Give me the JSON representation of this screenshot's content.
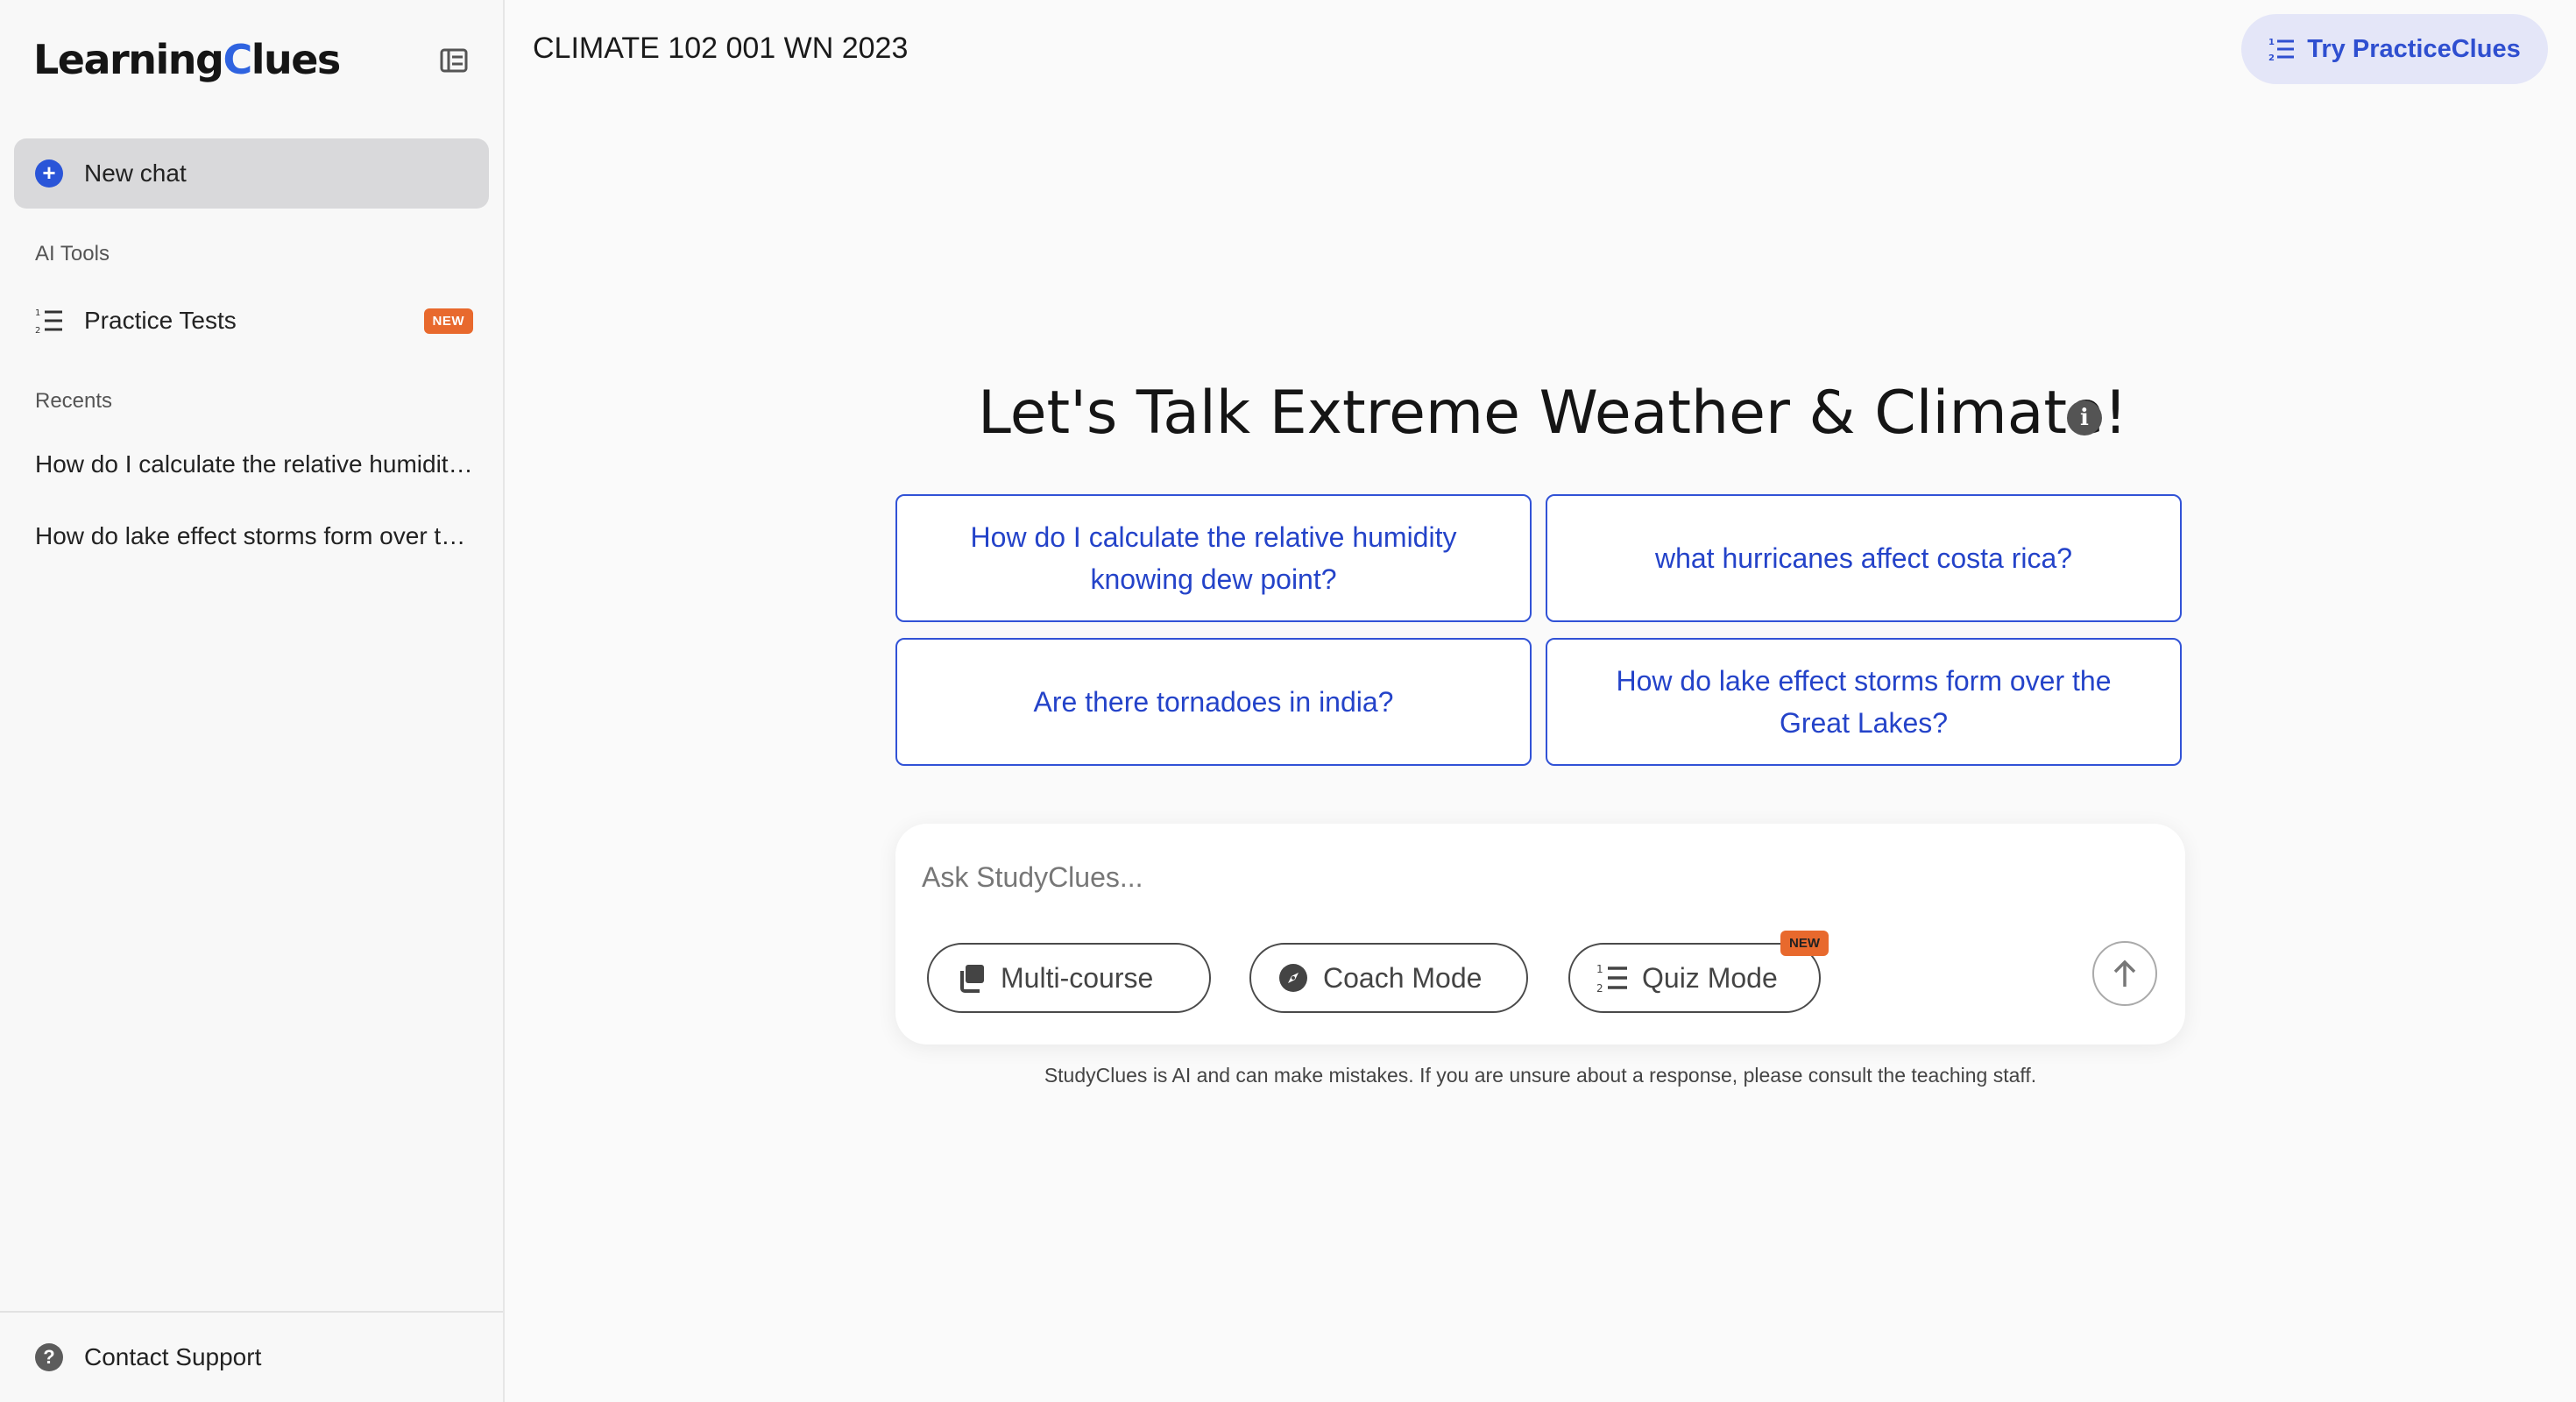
{
  "sidebar": {
    "logo": {
      "part1": "Learning",
      "part2": "C",
      "part3": "lues"
    },
    "new_chat_label": "New chat",
    "ai_tools_label": "AI Tools",
    "practice_tests_label": "Practice Tests",
    "practice_tests_badge": "NEW",
    "recents_label": "Recents",
    "recents": [
      "How do I calculate the relative humidity knowing dew point?",
      "How do lake effect storms form over the Great Lakes?"
    ],
    "contact_support_label": "Contact Support"
  },
  "header": {
    "course_title": "CLIMATE 102 001 WN 2023",
    "try_button_label": "Try PracticeClues"
  },
  "main": {
    "headline": "Let's Talk Extreme Weather & Climate!",
    "suggestions": [
      "How do I calculate the relative humidity knowing dew point?",
      "what hurricanes affect costa rica?",
      "Are there tornadoes in india?",
      "How do lake effect storms form over the Great Lakes?"
    ],
    "composer": {
      "placeholder": "Ask StudyClues...",
      "multi_course_label": "Multi-course",
      "coach_mode_label": "Coach Mode",
      "quiz_mode_label": "Quiz Mode",
      "quiz_mode_badge": "NEW"
    },
    "disclaimer": "StudyClues is AI and can make mistakes. If you are unsure about a response, please consult the teaching staff."
  },
  "colors": {
    "accent": "#2f4fd0",
    "badge": "#e8692d",
    "selected_bg": "#d9d9db"
  },
  "icons": [
    "sidebar-toggle-icon",
    "plus-icon",
    "list-numbered-icon",
    "question-icon",
    "info-icon",
    "copy-icon",
    "compass-icon",
    "arrow-up-icon"
  ]
}
